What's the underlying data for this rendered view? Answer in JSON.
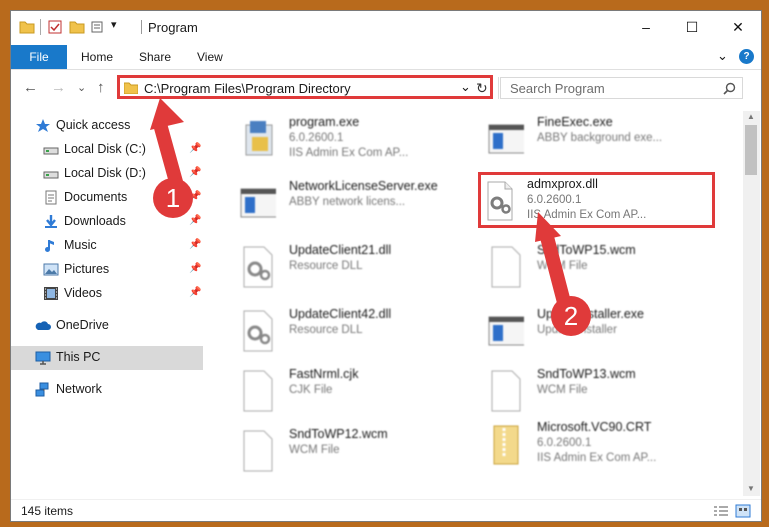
{
  "window": {
    "title": "Program",
    "controls": {
      "minimize": "–",
      "maximize": "☐",
      "close": "✕"
    }
  },
  "ribbon": {
    "tabs": [
      "File",
      "Home",
      "Share",
      "View"
    ],
    "expand": "⌄",
    "help": "?"
  },
  "address": {
    "path": "C:\\Program Files\\Program Directory",
    "dropdown": "⌄",
    "refresh": "↻"
  },
  "search": {
    "placeholder": "Search Program",
    "icon": "search-icon"
  },
  "nav": {
    "back": "←",
    "forward": "→",
    "recent": "⌄",
    "up": "↑"
  },
  "sidebar": {
    "items": [
      {
        "label": "Quick access",
        "icon": "star-icon"
      },
      {
        "label": "Local Disk (C:)",
        "icon": "drive-icon",
        "pinned": true
      },
      {
        "label": "Local Disk (D:)",
        "icon": "drive-icon",
        "pinned": true
      },
      {
        "label": "Documents",
        "icon": "documents-icon",
        "pinned": true
      },
      {
        "label": "Downloads",
        "icon": "download-icon",
        "pinned": true
      },
      {
        "label": "Music",
        "icon": "music-icon",
        "pinned": true
      },
      {
        "label": "Pictures",
        "icon": "pictures-icon",
        "pinned": true
      },
      {
        "label": "Videos",
        "icon": "videos-icon",
        "pinned": true
      },
      {
        "label": "OneDrive",
        "icon": "cloud-icon"
      },
      {
        "label": "This PC",
        "icon": "computer-icon",
        "selected": true
      },
      {
        "label": "Network",
        "icon": "network-icon"
      }
    ]
  },
  "files": [
    {
      "name": "program.exe",
      "line1": "6.0.2600.1",
      "line2": "IIS Admin Ex Com AP...",
      "icon": "exe-icon"
    },
    {
      "name": "FineExec.exe",
      "line1": "ABBY background exe...",
      "icon": "window-icon"
    },
    {
      "name": "NetworkLicenseServer.exe",
      "line1": "ABBY network licens...",
      "icon": "window-icon"
    },
    {
      "name": "admxprox.dll",
      "line1": "6.0.2600.1",
      "line2": "IIS Admin Ex Com AP...",
      "icon": "dll-gear-icon",
      "highlighted": true
    },
    {
      "name": "UpdateClient21.dll",
      "line1": "Resource DLL",
      "icon": "dll-gear-icon"
    },
    {
      "name": "SndToWP15.wcm",
      "line1": "WCM File",
      "icon": "file-icon"
    },
    {
      "name": "UpdateClient42.dll",
      "line1": "Resource DLL",
      "icon": "dll-gear-icon"
    },
    {
      "name": "UpdateInstaller.exe",
      "line1": "Update installer",
      "icon": "window-icon"
    },
    {
      "name": "FastNrml.cjk",
      "line1": "CJK File",
      "icon": "file-icon"
    },
    {
      "name": "SndToWP13.wcm",
      "line1": "WCM File",
      "icon": "file-icon"
    },
    {
      "name": "SndToWP12.wcm",
      "line1": "WCM File",
      "icon": "file-icon"
    },
    {
      "name": "Microsoft.VC90.CRT",
      "line1": "6.0.2600.1",
      "line2": "IIS Admin Ex Com AP...",
      "icon": "zip-icon"
    }
  ],
  "status": {
    "count": "145 items"
  },
  "annotations": [
    {
      "number": "1"
    },
    {
      "number": "2"
    }
  ],
  "colors": {
    "accent": "#1979ca",
    "highlight": "#e03a3a",
    "selection": "#d9d9d9"
  }
}
